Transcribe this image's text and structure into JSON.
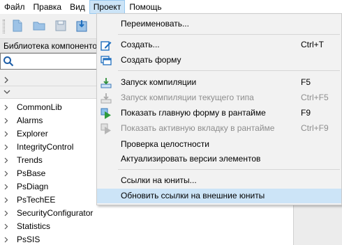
{
  "menubar": {
    "items": [
      {
        "label": "Файл"
      },
      {
        "label": "Правка"
      },
      {
        "label": "Вид"
      },
      {
        "label": "Проект"
      },
      {
        "label": "Помощь"
      }
    ]
  },
  "library": {
    "title": "Библиотека компоненто",
    "search_value": "",
    "tree_items": [
      {
        "label": "CommonLib"
      },
      {
        "label": "Alarms"
      },
      {
        "label": "Explorer"
      },
      {
        "label": "IntegrityControl"
      },
      {
        "label": "Trends"
      },
      {
        "label": "PsBase"
      },
      {
        "label": "PsDiagn"
      },
      {
        "label": "PsTechEE"
      },
      {
        "label": "SecurityConfigurator"
      },
      {
        "label": "Statistics"
      },
      {
        "label": "PsSIS"
      }
    ]
  },
  "project_menu": {
    "rename": {
      "label": "Переименовать..."
    },
    "create": {
      "label": "Создать...",
      "shortcut": "Ctrl+T"
    },
    "create_form": {
      "label": "Создать форму"
    },
    "compile": {
      "label": "Запуск компиляции",
      "shortcut": "F5"
    },
    "compile_type": {
      "label": "Запуск компиляции текущего типа",
      "shortcut": "Ctrl+F5"
    },
    "show_main_form": {
      "label": "Показать главную форму в рантайме",
      "shortcut": "F9"
    },
    "show_active_tab": {
      "label": "Показать активную вкладку в рантайме",
      "shortcut": "Ctrl+F9"
    },
    "integrity_check": {
      "label": "Проверка целостности"
    },
    "update_versions": {
      "label": "Актуализировать версии элементов"
    },
    "unit_links": {
      "label": "Ссылки на юниты..."
    },
    "update_external_links": {
      "label": "Обновить ссылки на внешние юниты"
    }
  },
  "colors": {
    "highlight": "#cce4f7",
    "disabled_text": "#8d8d8d",
    "accent_blue": "#1f6fbf"
  }
}
